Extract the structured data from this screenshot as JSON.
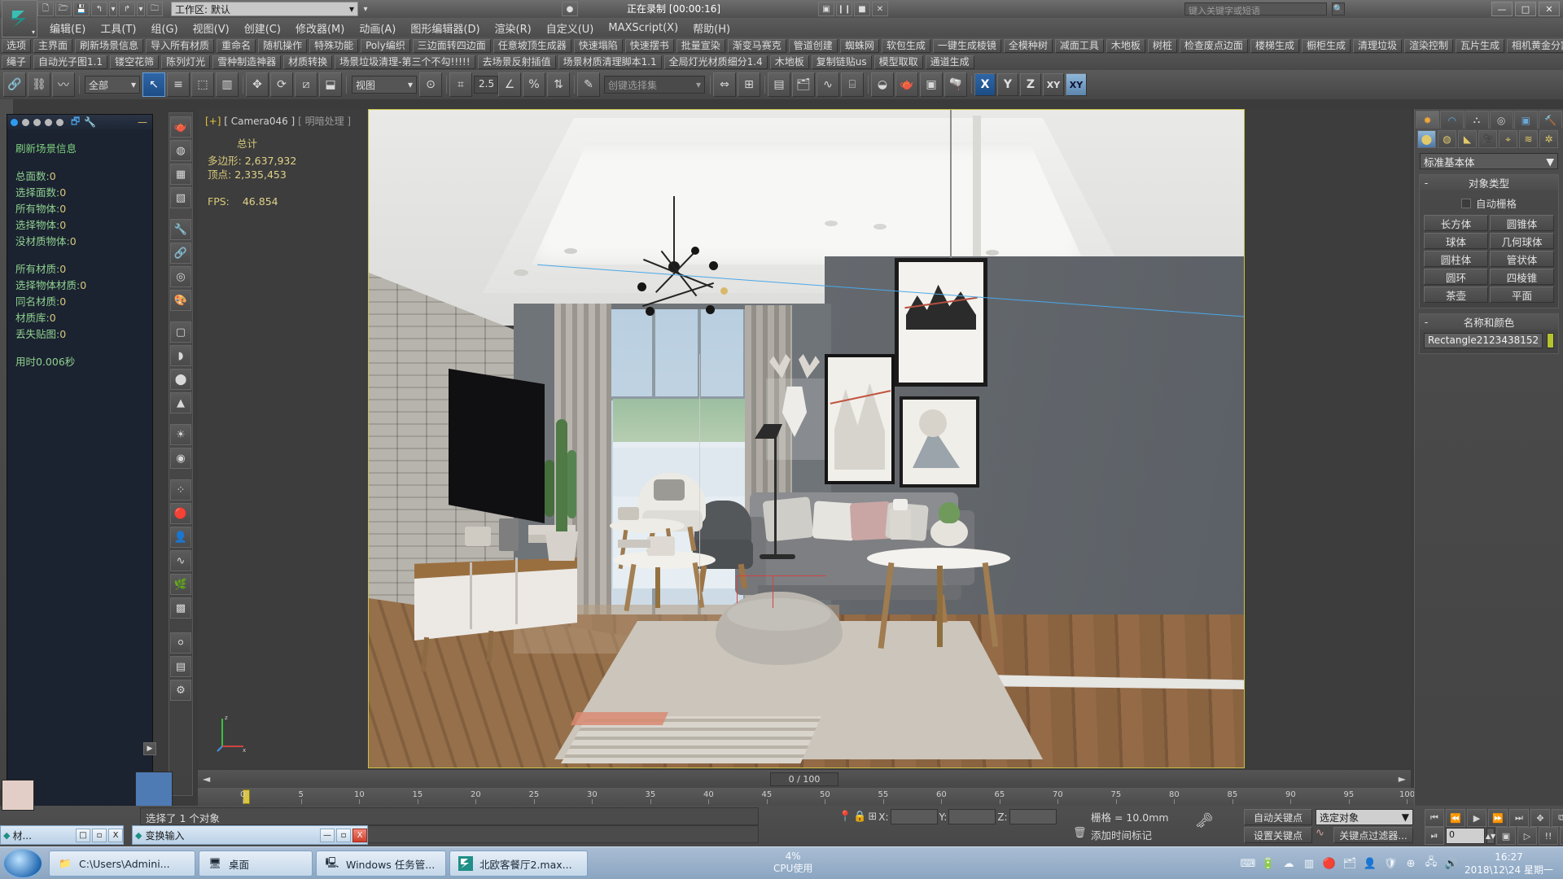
{
  "titlebar": {
    "recording_label": "正在录制 [00:00:16]",
    "search_placeholder": "键入关键字或短语",
    "min": "—",
    "max": "□",
    "close": "✕",
    "quick_icons": [
      "new-file",
      "open-file",
      "save-file",
      "undo",
      "redo",
      "set-project"
    ],
    "workspace_label": "工作区: 默认"
  },
  "menubar": {
    "items": [
      "编辑(E)",
      "工具(T)",
      "组(G)",
      "视图(V)",
      "创建(C)",
      "修改器(M)",
      "动画(A)",
      "图形编辑器(D)",
      "渲染(R)",
      "自定义(U)",
      "MAXScript(X)",
      "帮助(H)"
    ]
  },
  "scriptbar1": {
    "buttons": [
      "选项",
      "主界面",
      "刷新场景信息",
      "导入所有材质",
      "重命名",
      "随机操作",
      "特殊功能",
      "Poly编织",
      "三边面转四边面",
      "任意坡顶生成器",
      "快速塌陷",
      "快速摆书",
      "批量宣染",
      "渐变马赛克",
      "管道创建",
      "蜘蛛网",
      "软包生成",
      "一键生成棱镜",
      "全模种树",
      "减面工具",
      "木地板",
      "树桩",
      "检查废点边面",
      "楼梯生成",
      "橱柜生成",
      "清理垃圾",
      "渲染控制",
      "瓦片生成",
      "相机黄金分割线"
    ]
  },
  "scriptbar2": {
    "buttons": [
      "绳子",
      "自动光子图1.1",
      "镂空花筛",
      "陈列灯光",
      "雪种制造神器",
      "材质转换",
      "场景垃圾清理-第三个不勾!!!!!",
      "去场景反射插值",
      "场景材质清理脚本1.1",
      "全局灯光材质细分1.4",
      "木地板",
      "复制链贴us",
      "模型取取",
      "通道生成"
    ]
  },
  "maintoolbar": {
    "selection_filter": "全部",
    "ref_coord": "视图",
    "angle_snap": "2.5",
    "percent_snap": "%",
    "named_selection_placeholder": "创键选择集",
    "axis_x": "X",
    "axis_y": "Y",
    "axis_z": "Z",
    "axis_xy": "XY",
    "axis_xy2": "XY"
  },
  "scene_info": {
    "title": "刷新场景信息",
    "group1": [
      {
        "label": "总面数:",
        "value": "0"
      },
      {
        "label": "选择面数:",
        "value": "0"
      },
      {
        "label": "所有物体:",
        "value": "0"
      },
      {
        "label": "选择物体:",
        "value": "0"
      },
      {
        "label": "没材质物体:",
        "value": "0"
      }
    ],
    "group2": [
      {
        "label": "所有材质:",
        "value": "0"
      },
      {
        "label": "选择物体材质:",
        "value": "0"
      },
      {
        "label": "同名材质:",
        "value": "0"
      },
      {
        "label": "材质库:",
        "value": "0"
      },
      {
        "label": "丢失贴图:",
        "value": "0"
      }
    ],
    "group3": [
      {
        "label": "用时0.006秒",
        "value": ""
      }
    ]
  },
  "viewport": {
    "caption_plus": "[+]",
    "caption_cam": "[ Camera046 ]",
    "caption_shading": "[ 明暗处理 ]",
    "stats_title": "总计",
    "stats": [
      {
        "label": "多边形:",
        "value": "2,637,932"
      },
      {
        "label": "顶点:",
        "value": "2,335,453"
      }
    ],
    "fps_label": "FPS:",
    "fps_value": "46.854"
  },
  "timeline": {
    "frame_field": "0 / 100",
    "ruler_ticks": [
      "0",
      "5",
      "10",
      "15",
      "20",
      "25",
      "30",
      "35",
      "40",
      "45",
      "50",
      "55",
      "60",
      "65",
      "70",
      "75",
      "80",
      "85",
      "90",
      "95",
      "100"
    ]
  },
  "command_panel": {
    "tabs": [
      "create-tab",
      "modify-tab",
      "hierarchy-tab",
      "motion-tab",
      "display-tab",
      "utilities-tab"
    ],
    "categories": [
      "geometry-icon",
      "shapes-icon",
      "lights-icon",
      "cameras-icon",
      "helpers-icon",
      "space-warps-icon",
      "systems-icon"
    ],
    "category_combo": "标准基本体",
    "object_type": {
      "title": "对象类型",
      "minus": "-",
      "autogrid": "自动栅格",
      "buttons": [
        "长方体",
        "圆锥体",
        "球体",
        "几何球体",
        "圆柱体",
        "管状体",
        "圆环",
        "四棱锥",
        "茶壶",
        "平面"
      ]
    },
    "name_color": {
      "title": "名称和颜色",
      "minus": "-",
      "name_value": "Rectangle2123438152",
      "color": "#b5c32e"
    }
  },
  "statusbar": {
    "selection_text": "选择了 1 个对象",
    "x_label": "X:",
    "y_label": "Y:",
    "z_label": "Z:",
    "x_value": "",
    "y_value": "",
    "z_value": "",
    "grid_label": "栅格 = 10.0mm",
    "add_time_tag": "添加时间标记",
    "auto_key": "自动关键点",
    "set_key": "设置关键点",
    "key_filters": "关键点过滤器...",
    "selected_obj_combo": "选定对象",
    "key_frame_value": "0"
  },
  "mini_windows": [
    {
      "title": "材...",
      "buttons": [
        "□",
        "▫",
        "X"
      ]
    },
    {
      "title": "变换输入",
      "buttons": [
        "—",
        "▫",
        "X"
      ]
    }
  ],
  "taskbar": {
    "items": [
      {
        "label": "C:\\Users\\Admini...",
        "icon": "folder-icon"
      },
      {
        "label": "桌面",
        "icon": "desktop-icon"
      },
      {
        "label": "Windows 任务管...",
        "icon": "task-manager-icon"
      },
      {
        "label": "北欧客餐厅2.max...",
        "icon": "max-file-icon"
      }
    ],
    "cpu_percent": "4%",
    "cpu_label": "CPU使用",
    "time": "16:27",
    "date": "2018\\12\\24 星期一",
    "tray_icons": [
      "keyboard-icon",
      "usb-icon",
      "cloud-icon",
      "memory-icon",
      "record-icon",
      "folder-yellow-icon",
      "person-icon",
      "shield-icon",
      "update-icon",
      "network-icon",
      "volume-icon"
    ]
  }
}
